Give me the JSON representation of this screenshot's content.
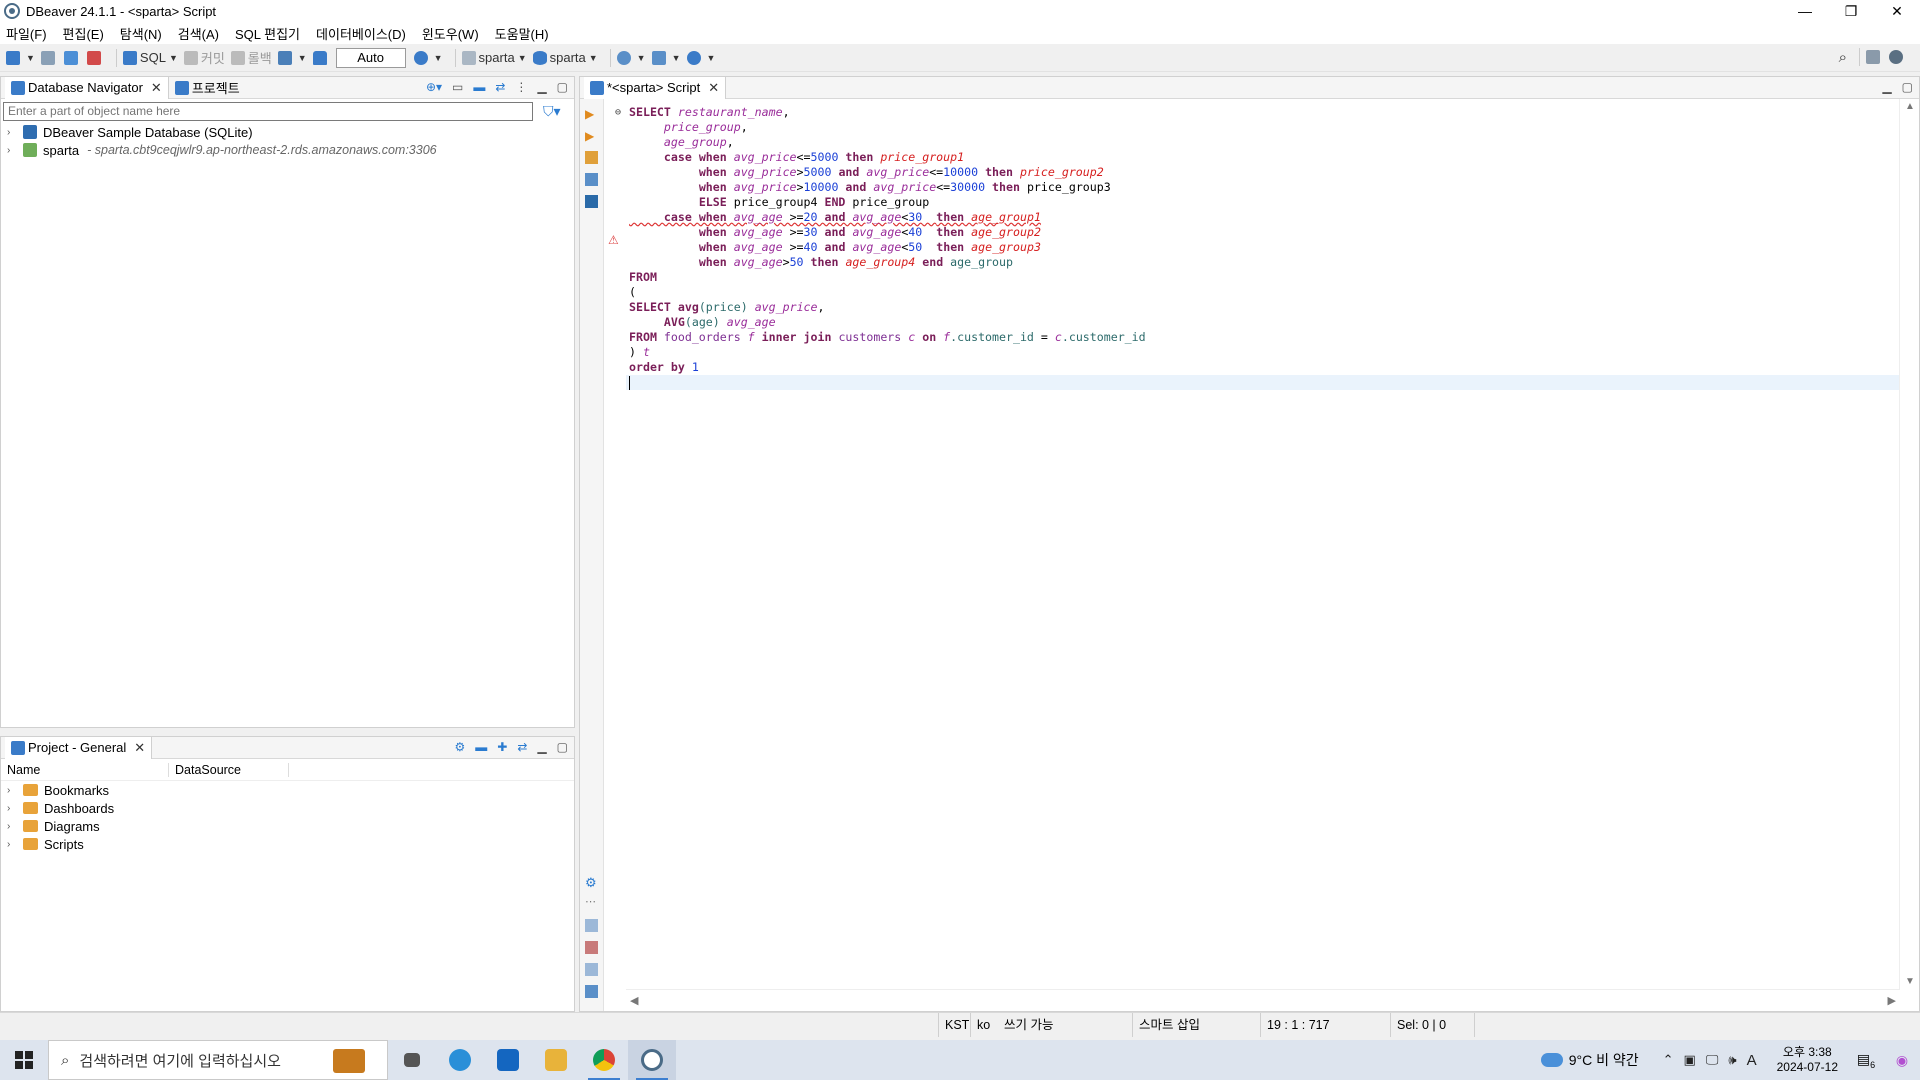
{
  "window": {
    "title": "DBeaver 24.1.1 - <sparta> Script",
    "minimize": "—",
    "maximize": "❐",
    "close": "✕"
  },
  "menu": [
    "파일(F)",
    "편집(E)",
    "탐색(N)",
    "검색(A)",
    "SQL 편집기",
    "데이터베이스(D)",
    "윈도우(W)",
    "도움말(H)"
  ],
  "toolbar": {
    "sql_label": "SQL",
    "commit_label": "커밋",
    "rollback_label": "롤백",
    "transaction_mode": "Auto",
    "datasource": "sparta",
    "schema": "sparta"
  },
  "navigator": {
    "tab_label": "Database Navigator",
    "projects_tab_label": "프로젝트",
    "filter_placeholder": "Enter a part of object name here",
    "items": [
      {
        "label": "DBeaver Sample Database (SQLite)",
        "meta": ""
      },
      {
        "label": "sparta",
        "meta": "- sparta.cbt9ceqjwlr9.ap-northeast-2.rds.amazonaws.com:3306"
      }
    ]
  },
  "project": {
    "tab_label": "Project - General",
    "columns": [
      "Name",
      "DataSource"
    ],
    "items": [
      "Bookmarks",
      "Dashboards",
      "Diagrams",
      "Scripts"
    ]
  },
  "editor": {
    "tab_label": "*<sparta> Script"
  },
  "code": {
    "l1": {
      "kw1": "SELECT",
      "id1": "restaurant_name",
      "p1": ","
    },
    "l2": {
      "id1": "price_group",
      "p1": ","
    },
    "l3": {
      "id1": "age_group",
      "p1": ","
    },
    "l4": {
      "kw1": "case",
      "kw2": "when",
      "id1": "avg_price",
      "op": "<=",
      "num": "5000",
      "kw3": "then",
      "idr": "price_group1"
    },
    "l5": {
      "kw1": "when",
      "id1": "avg_price",
      "op1": ">",
      "num1": "5000",
      "kw2": "and",
      "id2": "avg_price",
      "op2": "<=",
      "num2": "10000",
      "kw3": "then",
      "idr": "price_group2"
    },
    "l6": {
      "kw1": "when",
      "id1": "avg_price",
      "op1": ">",
      "num1": "10000",
      "kw2": "and",
      "id2": "avg_price",
      "op2": "<=",
      "num2": "30000",
      "kw3": "then",
      "plain": "price_group3"
    },
    "l7": {
      "kw1": "ELSE",
      "plain1": "price_group4",
      "kw2": "END",
      "plain2": "price_group"
    },
    "l8": {
      "kw1": "case",
      "kw2": "when",
      "id1": "avg_age",
      "op1": " >=",
      "num1": "20",
      "kw3": "and",
      "id2": "avg_age",
      "op2": "<",
      "num2": "30",
      "kw4": "then",
      "idr": "age_group1"
    },
    "l9": {
      "kw1": "when",
      "id1": "avg_age",
      "op1": " >=",
      "num1": "30",
      "kw2": "and",
      "id2": "avg_age",
      "op2": "<",
      "num2": "40",
      "kw3": "then",
      "idr": "age_group2"
    },
    "l10": {
      "kw1": "when",
      "id1": "avg_age",
      "op1": " >=",
      "num1": "40",
      "kw2": "and",
      "id2": "avg_age",
      "op2": "<",
      "num2": "50",
      "kw3": "then",
      "idr": "age_group3"
    },
    "l11": {
      "kw1": "when",
      "id1": "avg_age",
      "op1": ">",
      "num1": "50",
      "kw2": "then",
      "idr": "age_group4",
      "kw3": "end",
      "col": "age_group"
    },
    "l12": {
      "kw1": "FROM"
    },
    "l13": {
      "p1": "("
    },
    "l14": {
      "kw1": "SELECT",
      "kw2": "avg",
      "p1": "(price)",
      "id1": "avg_price",
      "p2": ","
    },
    "l15": {
      "kw1": "AVG",
      "p1": "(age)",
      "id1": "avg_age"
    },
    "l16": {
      "kw1": "FROM",
      "tbl1": "food_orders",
      "id1": "f",
      "kw2": "inner join",
      "tbl2": "customers",
      "id2": "c",
      "kw3": "on",
      "id3": "f",
      "col1": ".customer_id",
      "p1": " = ",
      "id4": "c",
      "col2": ".customer_id"
    },
    "l17": {
      "p1": ")",
      "id1": "t"
    },
    "l18": {
      "kw1": "order by",
      "num1": "1"
    }
  },
  "status": {
    "timezone": "KST",
    "locale": "ko",
    "mode": "쓰기 가능",
    "insert": "스마트 삽입",
    "position": "19 : 1 : 717",
    "selection": "Sel: 0 | 0"
  },
  "taskbar": {
    "search_placeholder": "검색하려면 여기에 입력하십시오",
    "weather": "9°C  비 약간",
    "time": "오후 3:38",
    "date": "2024-07-12",
    "ime": "A",
    "notification_count": "6"
  },
  "colors": {
    "accent": "#3d7fd0",
    "keyword": "#7a1e58",
    "number": "#1a3fd6",
    "error": "#d62020"
  }
}
